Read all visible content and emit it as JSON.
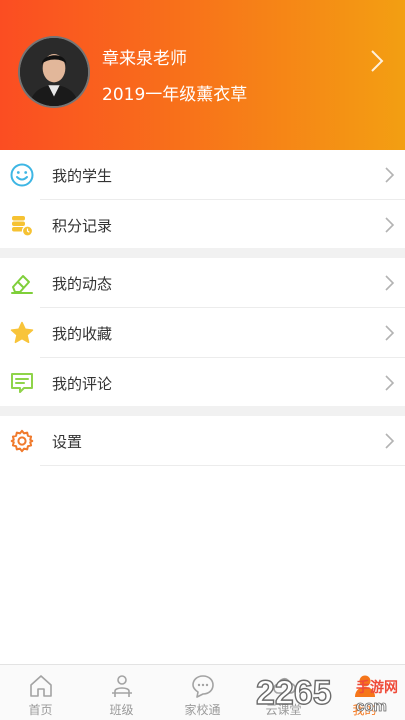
{
  "profile": {
    "name": "章来泉老师",
    "class_name": "2019一年级薰衣草"
  },
  "menu": {
    "students": "我的学生",
    "points": "积分记录",
    "moments": "我的动态",
    "favorites": "我的收藏",
    "comments": "我的评论",
    "settings": "设置"
  },
  "tabbar": {
    "home": "首页",
    "class": "班级",
    "home_school": "家校通",
    "cloud_class": "云课堂",
    "mine": "我的"
  },
  "watermark": {
    "number": "2265",
    "cn": "手游网",
    "domain": "com"
  },
  "colors": {
    "accent": "#f5761a",
    "header_start": "#fb4d22",
    "header_end": "#f39f12"
  }
}
